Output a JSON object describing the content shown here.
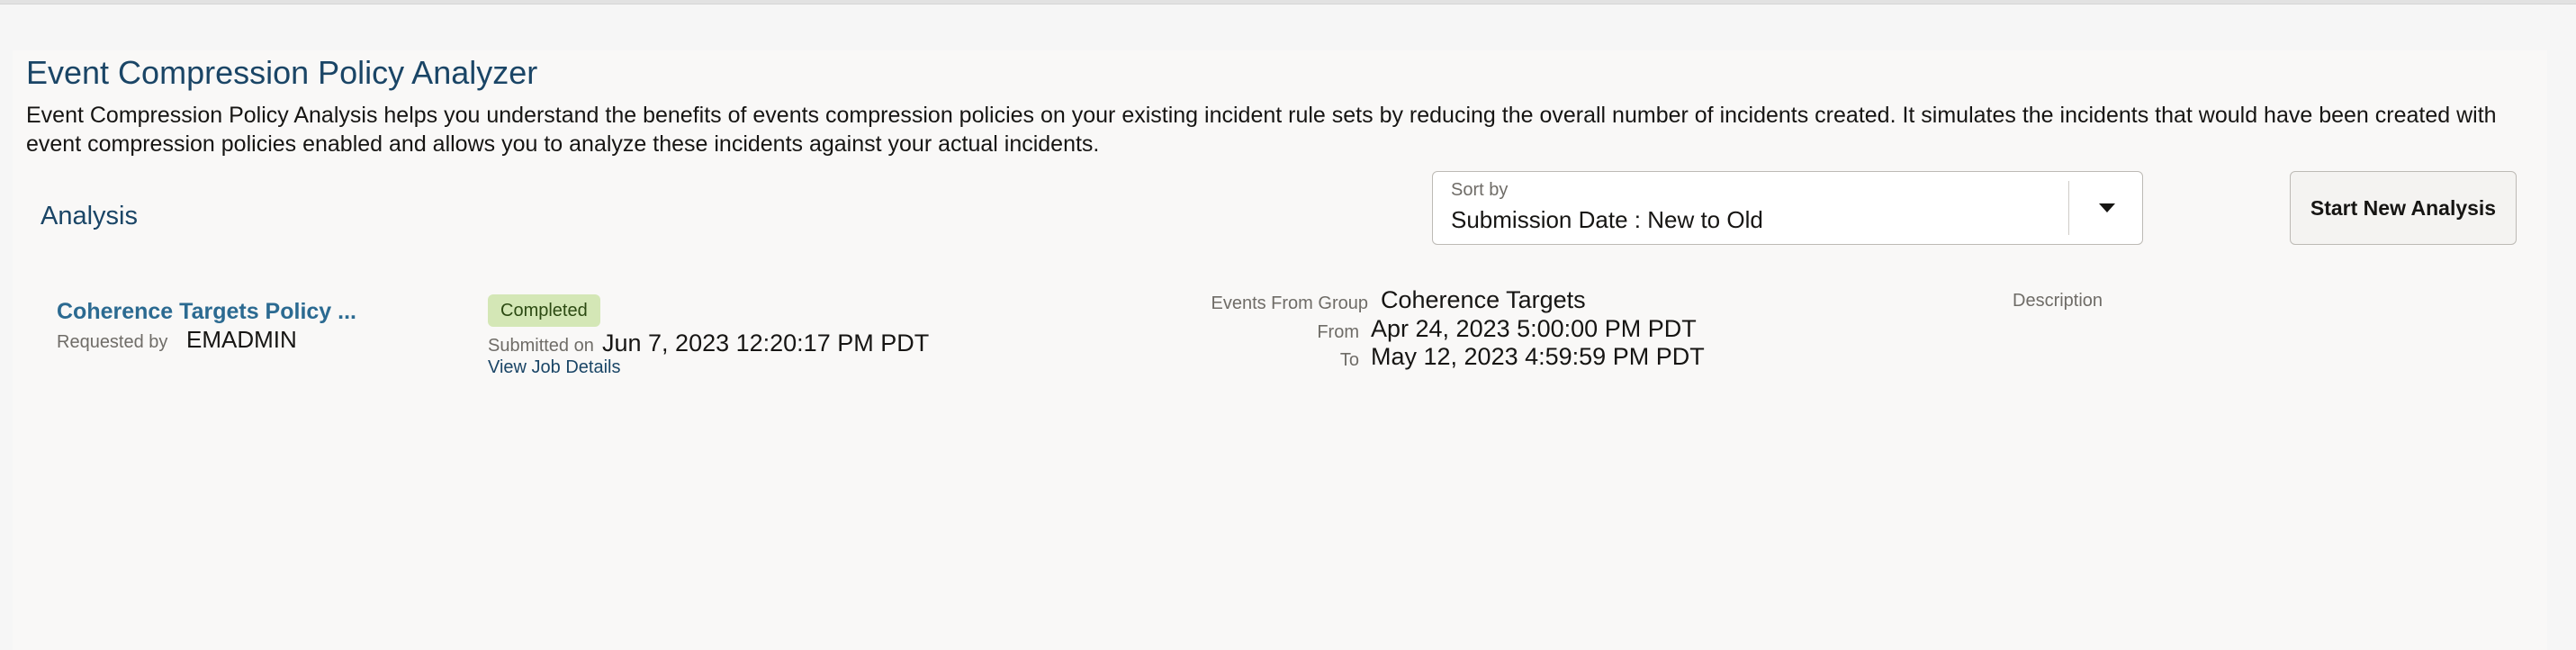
{
  "page": {
    "title": "Event Compression Policy Analyzer",
    "description": "Event Compression Policy Analysis helps you understand the benefits of events compression policies on your existing incident rule sets by reducing the overall number of incidents created. It simulates the incidents that would have been created with event compression policies enabled and allows you to analyze these incidents against your actual incidents."
  },
  "analysis": {
    "section_title": "Analysis",
    "sort": {
      "label": "Sort by",
      "selected": "Submission Date : New to Old"
    },
    "start_button_label": "Start New Analysis",
    "items": [
      {
        "name": "Coherence Targets Policy ...",
        "requested_by_label": "Requested by",
        "requested_by": "EMADMIN",
        "status": "Completed",
        "submitted_on_label": "Submitted on",
        "submitted_on": "Jun 7, 2023 12:20:17 PM PDT",
        "job_details_label": "View Job Details",
        "events_group_label": "Events From Group",
        "events_group": "Coherence Targets",
        "from_label": "From",
        "from": "Apr 24, 2023 5:00:00 PM PDT",
        "to_label": "To",
        "to": "May 12, 2023 4:59:59 PM PDT",
        "description_label": "Description"
      }
    ]
  },
  "colors": {
    "heading": "#1a4566",
    "link": "#2b6a91",
    "status_badge_bg": "#d4e7b6",
    "page_bg": "#f9f8f7"
  },
  "icons": {
    "sort_dropdown": "caret-down-icon"
  }
}
